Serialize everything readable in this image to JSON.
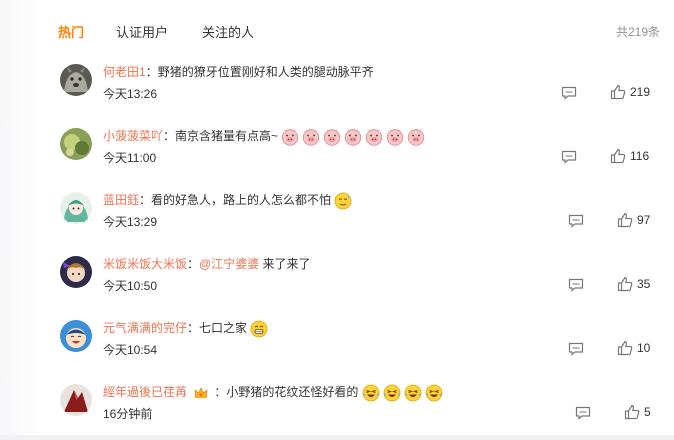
{
  "tabs": [
    {
      "label": "热门",
      "active": true
    },
    {
      "label": "认证用户",
      "active": false
    },
    {
      "label": "关注的人",
      "active": false
    }
  ],
  "total_label": "共219条",
  "colors": {
    "accent": "#ff8200",
    "username": "#eb7350"
  },
  "comments": [
    {
      "user": "何老田1",
      "sep": "：",
      "text": "野猪的獠牙位置刚好和人类的腿动脉平齐",
      "time": "今天13:26",
      "likes": "219"
    },
    {
      "user": "小菠菠菜吖",
      "sep": "：",
      "text": "南京含猪量有点高~",
      "emoji": "pig-face",
      "emoji_count": 7,
      "time": "今天11:00",
      "likes": "116"
    },
    {
      "user": "蓝田鈺",
      "sep": "：",
      "text": "看的好急人，路上的人怎么都不怕",
      "emoji": "sweat-smile",
      "emoji_count": 1,
      "time": "今天13:29",
      "likes": "97"
    },
    {
      "user": "米饭米饭大米饭",
      "sep": "：",
      "mention": "@江宁婆婆",
      "text": " 来了来了",
      "time": "今天10:50",
      "likes": "35"
    },
    {
      "user": "元气满满的完仔",
      "sep": "：",
      "text": "七口之家",
      "emoji": "grin",
      "emoji_count": 1,
      "time": "今天10:54",
      "likes": "10"
    },
    {
      "user": "經年過後已荏苒",
      "badge": "crown-icon",
      "sep": "：",
      "text": "小野猪的花纹还怪好看的",
      "emoji": "laugh-tears",
      "emoji_count": 4,
      "time": "16分钟前",
      "likes": "5"
    }
  ]
}
